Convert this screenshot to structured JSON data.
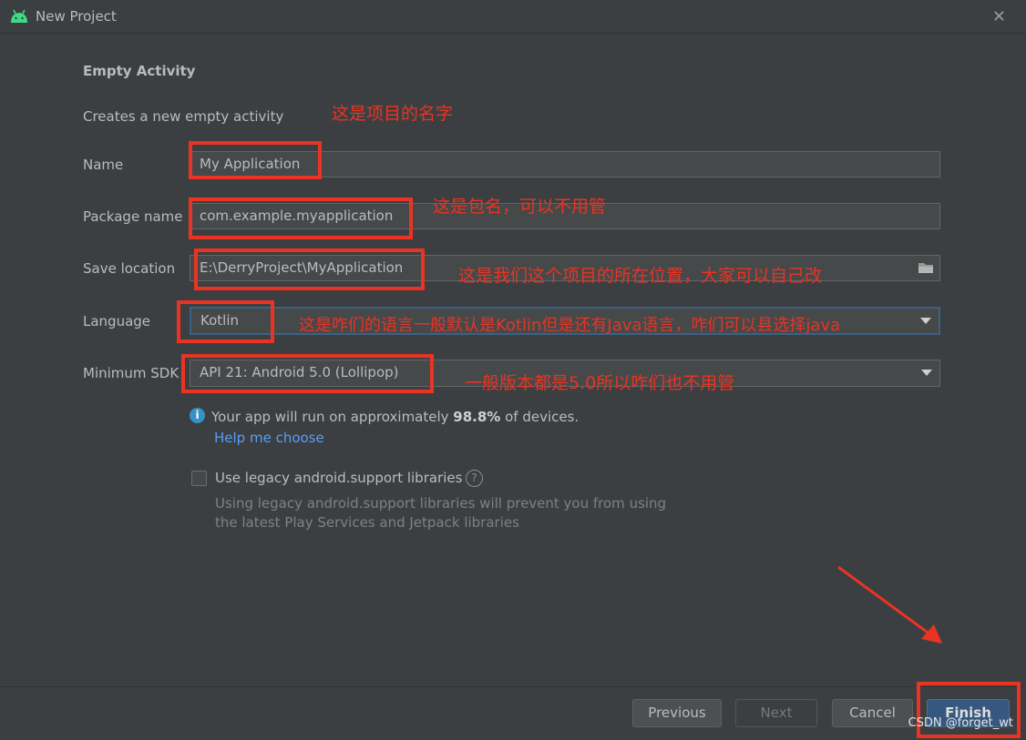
{
  "window": {
    "title": "New Project",
    "close_glyph": "✕",
    "app_icon": "android-icon"
  },
  "page": {
    "heading": "Empty Activity",
    "description": "Creates a new empty activity"
  },
  "form": {
    "name": {
      "label": "Name",
      "value": "My Application"
    },
    "package": {
      "label": "Package name",
      "value": "com.example.myapplication"
    },
    "location": {
      "label": "Save location",
      "value": "E:\\DerryProject\\MyApplication",
      "icon": "folder-icon"
    },
    "language": {
      "label": "Language",
      "value": "Kotlin"
    },
    "min_sdk": {
      "label": "Minimum SDK",
      "value": "API 21: Android 5.0 (Lollipop)"
    }
  },
  "info": {
    "prefix": "Your app will run on approximately ",
    "percent": "98.8%",
    "suffix": " of devices.",
    "link": "Help me choose"
  },
  "legacy": {
    "label": "Use legacy android.support libraries",
    "checked": false,
    "hint_line1": "Using legacy android.support libraries will prevent you from using",
    "hint_line2": "the latest Play Services and Jetpack libraries"
  },
  "buttons": {
    "previous": "Previous",
    "next": "Next",
    "cancel": "Cancel",
    "finish": "Finish"
  },
  "annotations": {
    "name_note": "这是项目的名字",
    "package_note": "这是包名，可以不用管",
    "location_note": "这是我们这个项目的所在位置，大家可以自己改",
    "language_note": "这是咋们的语言一般默认是Kotlin但是还有Java语言，咋们可以县选择java",
    "sdk_note": "一般版本都是5.0所以咋们也不用管"
  },
  "watermark": "CSDN @forget_wt",
  "colors": {
    "background": "#3c3f41",
    "field": "#45494a",
    "link": "#589df6",
    "primary_button": "#365880",
    "annotation": "#ea3323"
  }
}
